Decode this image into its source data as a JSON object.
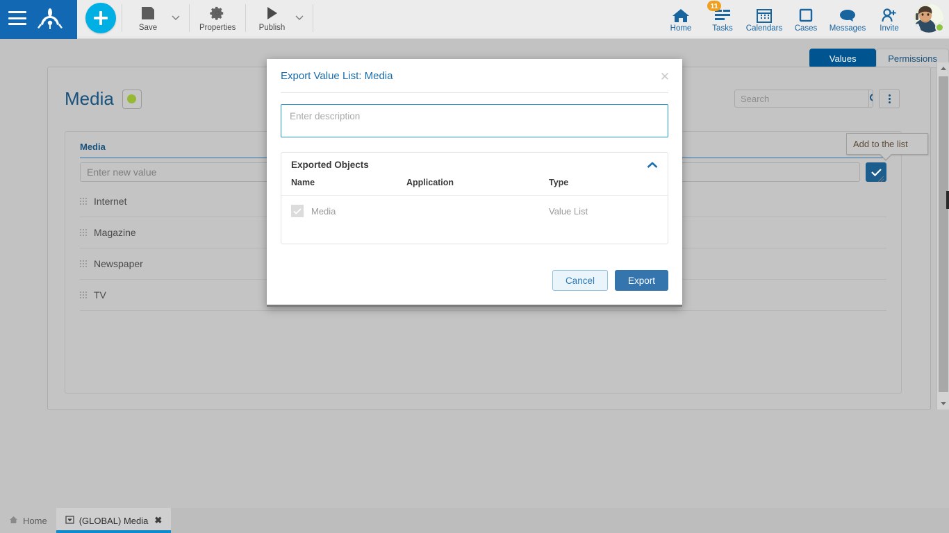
{
  "toolbar": {
    "menu_icon": "hamburger-icon",
    "logo_icon": "frog-logo-icon",
    "add_icon": "plus-icon",
    "items": [
      {
        "label": "Save",
        "icon": "save-floppy-icon",
        "has_caret": true
      },
      {
        "label": "Properties",
        "icon": "gear-icon",
        "has_caret": false
      },
      {
        "label": "Publish",
        "icon": "play-triangle-icon",
        "has_caret": true
      }
    ],
    "right_items": [
      {
        "label": "Home",
        "icon": "home-icon",
        "badge": ""
      },
      {
        "label": "Tasks",
        "icon": "tasks-list-icon",
        "badge": "11"
      },
      {
        "label": "Calendars",
        "icon": "calendar-icon",
        "badge": ""
      },
      {
        "label": "Cases",
        "icon": "square-outline-icon",
        "badge": ""
      },
      {
        "label": "Messages",
        "icon": "speech-bubble-icon",
        "badge": ""
      },
      {
        "label": "Invite",
        "icon": "person-add-icon",
        "badge": ""
      }
    ],
    "avatar": "user-avatar",
    "online_status": "online"
  },
  "page_tabs": [
    {
      "label": "Values",
      "active": true
    },
    {
      "label": "Permissions",
      "active": false
    }
  ],
  "page": {
    "title": "Media",
    "status_dot_color": "#96b832",
    "search_placeholder": "Search",
    "search_value": "",
    "search_icon": "search-icon",
    "more_icon": "kebab-menu-icon",
    "card_header": "Media",
    "new_value_placeholder": "Enter new value",
    "new_value": "",
    "add_button_icon": "check-icon",
    "tooltip_text": "Add to the list",
    "values": [
      "Internet",
      "Magazine",
      "Newspaper",
      "TV"
    ]
  },
  "modal": {
    "title": "Export Value List: Media",
    "close_icon": "close-icon",
    "description_placeholder": "Enter description",
    "description_value": "",
    "panel_title": "Exported Objects",
    "collapse_icon": "chevron-up-icon",
    "columns": [
      "Name",
      "Application",
      "Type"
    ],
    "rows": [
      {
        "name": "Media",
        "application": "",
        "type": "Value List",
        "checked": true,
        "disabled": true
      }
    ],
    "cancel_label": "Cancel",
    "export_label": "Export",
    "accent_color": "#3575ad",
    "focus_border_color": "#2196c9"
  },
  "taskbar": {
    "tabs": [
      {
        "label": "Home",
        "icon": "home-small-icon",
        "active": false,
        "closable": false
      },
      {
        "label": "(GLOBAL) Media",
        "icon": "window-small-icon",
        "active": true,
        "closable": true,
        "close_icon": "close-x-icon"
      }
    ]
  },
  "scrollbar": {
    "up_icon": "arrow-up-icon",
    "down_icon": "arrow-down-icon"
  }
}
